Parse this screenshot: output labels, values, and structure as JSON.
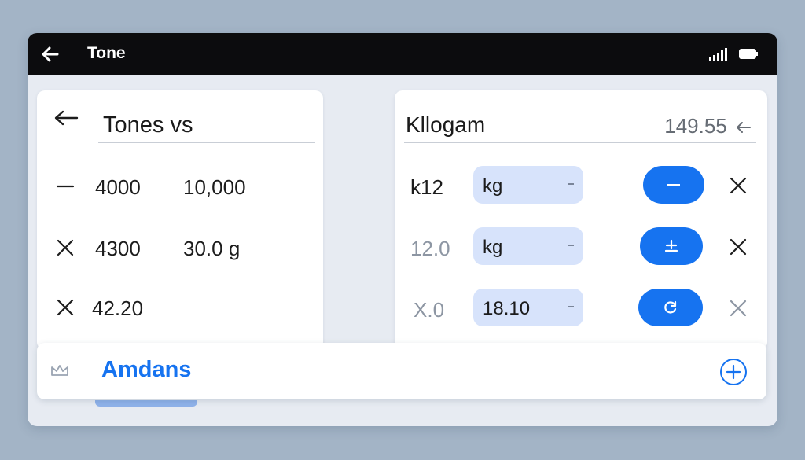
{
  "titlebar": {
    "title": "Tone"
  },
  "left_panel": {
    "title": "Tones  vs",
    "rows": [
      {
        "icon": "minus-icon",
        "value1": "4000",
        "value2": "10,000"
      },
      {
        "icon": "close-icon",
        "value1": "4300",
        "value2": "30.0 g"
      },
      {
        "icon": "close-icon",
        "value1": "42.20",
        "value2": ""
      }
    ]
  },
  "right_panel": {
    "title": "Kllogam",
    "value": "149.55",
    "rows": [
      {
        "label": "k12",
        "select_value": "kg",
        "button_icon": "minus-icon"
      },
      {
        "label": "12.0",
        "select_value": "kg",
        "button_icon": "plus-minus-icon"
      },
      {
        "label": "X.0",
        "select_value": "18.10",
        "button_icon": "cycle-icon"
      }
    ]
  },
  "bottom_bar": {
    "label": "Amdans",
    "icon": "crown-icon",
    "action_icon": "add-circle-icon"
  },
  "colors": {
    "accent": "#1673f0",
    "select_bg": "#d7e3fb",
    "titlebar_bg": "#0c0c0e",
    "page_bg": "#a3b4c6"
  }
}
